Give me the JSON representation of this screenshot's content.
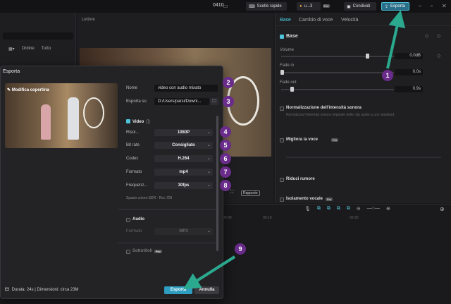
{
  "topbar": {
    "project": "0410",
    "shortcuts_label": "Scelte rapide",
    "user_label": "u...3",
    "pro_label": "Pro",
    "share_label": "Condividi",
    "export_label": "Esporta"
  },
  "left": {
    "sort_label": "Ordine",
    "all_label": "Tutto"
  },
  "player": {
    "label": "Lettore",
    "ratio_label": "Rapporto"
  },
  "right": {
    "tabs": [
      "Base",
      "Cambio di voce",
      "Velocità"
    ],
    "base_header": "Base",
    "volume_label": "Volume",
    "volume_value": "0.0dB",
    "fadein_label": "Fade in",
    "fadein_value": "0.0s",
    "fadeout_label": "Fade out",
    "fadeout_value": "0.9s",
    "normalize_label": "Normalizzazione dell'intensità sonora",
    "normalize_sub": "Normalizza l'intensità sonora originale delle clip audio a uno standard.",
    "enhance_label": "Migliora la voce",
    "noise_label": "Riduci rumore",
    "isolate_label": "Isolamento vocale"
  },
  "timeline": {
    "times": [
      "00:00",
      "00:10",
      "00:20"
    ]
  },
  "modal": {
    "title": "Esporta",
    "cover_label": "Modifica copertina",
    "name_label": "Nome",
    "name_value": "video con audio mixato",
    "export_to_label": "Esporta su",
    "export_to_value": "D:/Users/parsi/Downl...",
    "video_section": "Video",
    "resolution_label": "Risol...",
    "resolution_value": "1080P",
    "bitrate_label": "Bit rate",
    "bitrate_value": "Consigliato",
    "codec_label": "Codec",
    "codec_value": "H.264",
    "format_label": "Formato",
    "format_value": "mp4",
    "framerate_label": "Frequenz...",
    "framerate_value": "30fps",
    "color_space": "Spazio colore:SDR - Rec.709",
    "audio_section": "Audio",
    "audio_format_label": "Formato",
    "audio_format_value": "MP3",
    "subtitles_section": "Sottotitoli",
    "footer_info": "Durata: 24s | Dimensioni: circa 23M",
    "export_button": "Esporta",
    "cancel_button": "Annulla"
  },
  "callouts": [
    "1",
    "2",
    "3",
    "4",
    "5",
    "6",
    "7",
    "8",
    "9"
  ],
  "colors": {
    "accent": "#4fc3d9",
    "export_btn": "#2e9ec0",
    "callout": "#6a2c8a",
    "arrow": "#2aa98f"
  }
}
